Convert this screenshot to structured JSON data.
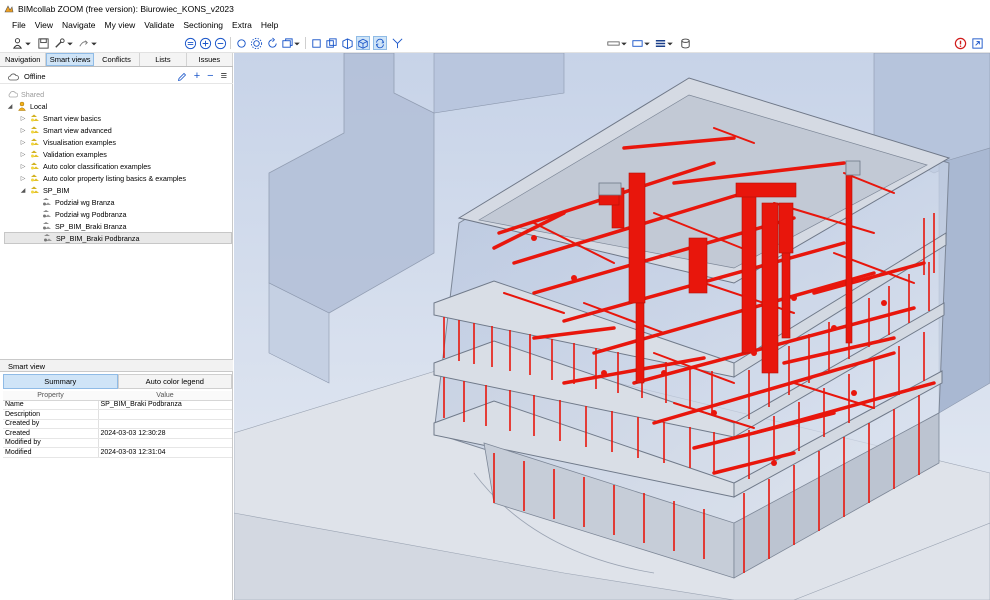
{
  "window": {
    "title": "BIMcollab ZOOM (free version): Biurowiec_KONS_v2023"
  },
  "menu": [
    "File",
    "View",
    "Navigate",
    "My view",
    "Validate",
    "Sectioning",
    "Extra",
    "Help"
  ],
  "tabs": [
    "Navigation",
    "Smart views",
    "Conflicts",
    "Lists",
    "Issues"
  ],
  "active_tab": "Smart views",
  "status": {
    "label": "Offline",
    "actions": [
      "pencil",
      "+",
      "−",
      "≡"
    ]
  },
  "tree": [
    {
      "label": "Shared",
      "muted": true
    },
    {
      "label": "Local"
    },
    {
      "label": "Smart view basics"
    },
    {
      "label": "Smart view advanced"
    },
    {
      "label": "Visualisation examples"
    },
    {
      "label": "Validation examples"
    },
    {
      "label": "Auto color classification examples"
    },
    {
      "label": "Auto color property listing basics & examples"
    },
    {
      "label": "SP_BIM"
    },
    {
      "label": "Podział wg Branza"
    },
    {
      "label": "Podział wg Podbranza"
    },
    {
      "label": "SP_BIM_Braki Branza"
    },
    {
      "label": "SP_BIM_Braki Podbranza",
      "selected": true
    }
  ],
  "smart_view": {
    "header": "Smart view",
    "tabs": [
      "Summary",
      "Auto color legend"
    ],
    "columns": [
      "Property",
      "Value"
    ],
    "rows": [
      {
        "property": "Name",
        "value": "SP_BIM_Braki Podbranza"
      },
      {
        "property": "Description",
        "value": ""
      },
      {
        "property": "Created by",
        "value": ""
      },
      {
        "property": "Created",
        "value": "2024-03-03 12:30:28"
      },
      {
        "property": "Modified by",
        "value": ""
      },
      {
        "property": "Modified",
        "value": "2024-03-03 12:31:04"
      }
    ]
  },
  "colors": {
    "accent": "#cfe4f7",
    "highlight": "#e8160c",
    "building": "#c9ccd2"
  }
}
